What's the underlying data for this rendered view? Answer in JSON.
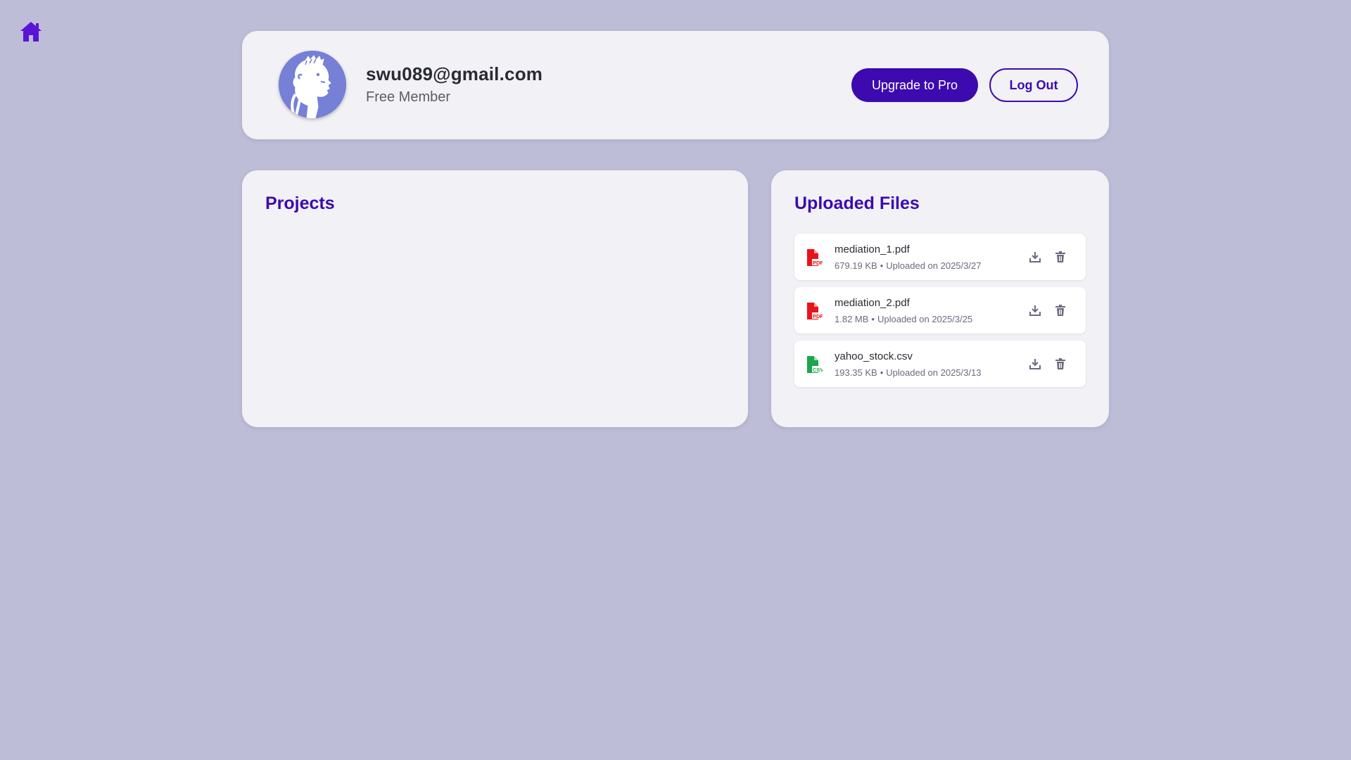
{
  "nav": {
    "home_icon": "home-icon"
  },
  "profile": {
    "email": "swu089@gmail.com",
    "tier": "Free Member",
    "upgrade_label": "Upgrade to Pro",
    "logout_label": "Log Out"
  },
  "projects": {
    "title": "Projects",
    "items": []
  },
  "files": {
    "title": "Uploaded Files",
    "items": [
      {
        "name": "mediation_1.pdf",
        "size": "679.19 KB",
        "uploaded": "Uploaded on 2025/3/27",
        "type": "PDF"
      },
      {
        "name": "mediation_2.pdf",
        "size": "1.82 MB",
        "uploaded": "Uploaded on 2025/3/25",
        "type": "PDF"
      },
      {
        "name": "yahoo_stock.csv",
        "size": "193.35 KB",
        "uploaded": "Uploaded on 2025/3/13",
        "type": "CSV"
      }
    ],
    "separator": "•"
  },
  "colors": {
    "background": "#bdbdd7",
    "accent": "#3d0aaf",
    "home_icon": "#5b14d6",
    "pdf": "#e8141b",
    "csv": "#1aa64b",
    "avatar": "#7580d6"
  }
}
